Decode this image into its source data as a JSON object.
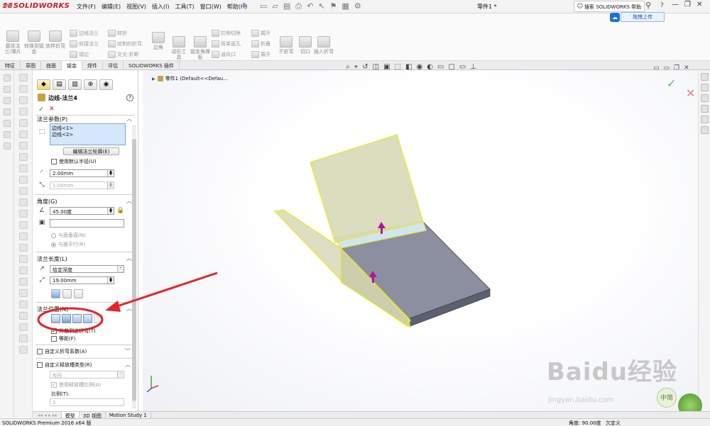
{
  "app": {
    "brand": "SOLIDWORKS",
    "document_title": "零件1 *"
  },
  "menu": [
    "文件(F)",
    "编辑(E)",
    "视图(V)",
    "插入(I)",
    "工具(T)",
    "窗口(W)",
    "帮助(H)"
  ],
  "search": {
    "placeholder": "搜索 SOLIDWORKS 帮助"
  },
  "upload_button": "拖拽上传",
  "ribbon": {
    "big": [
      "基体法兰/薄片",
      "转换到钣金",
      "放样折弯"
    ],
    "col1": [
      "边线法兰",
      "斜接法兰",
      "褶边"
    ],
    "col2": [
      "转折",
      "绘制的折弯",
      "交叉-折断"
    ],
    "corner": "边角",
    "forming": "成形工具",
    "gusset": "钣金角撑板",
    "col3": [
      "拉伸切除",
      "简单直孔",
      "通风口"
    ],
    "col4": [
      "展开",
      "折叠",
      "展开"
    ],
    "nofold": "不折弯",
    "rip": "切口",
    "insert_bends": "插入折弯"
  },
  "tabs": [
    "特征",
    "草图",
    "曲面",
    "钣金",
    "焊件",
    "评估",
    "SOLIDWORKS 插件"
  ],
  "active_tab_index": 3,
  "pm": {
    "title": "边线-法兰4",
    "sections": {
      "params": "法兰参数(P)",
      "angle": "角度(G)",
      "length": "法兰长度(L)",
      "position": "法兰位置(N)",
      "custom_bend": "自定义折弯系数(A)",
      "custom_relief": "自定义释放槽类型(R)"
    },
    "edges": [
      "边线<1>",
      "边线<2>"
    ],
    "edit_profile_button": "编辑法兰轮廓(E)",
    "use_default_radius": "使用默认半径(U)",
    "radius_value": "2.00mm",
    "thickness_value": "1.00mm",
    "angle_value": "45.00度",
    "radio_perpendicular": "与面垂直(N)",
    "radio_parallel": "与面平行(R)",
    "length_type": "给定深度",
    "length_value": "19.00mm",
    "trim_side_bends": "剪裁侧边折弯(T)",
    "offset": "等距(F)",
    "relief_type": "矩形",
    "use_relief_ratio": "使用释放槽比例(A)",
    "ratio_label": "比例(T):",
    "ratio_value": "1"
  },
  "tree_root": "零件1 (Default<<Defau...",
  "bottom_tabs": [
    "模型",
    "3D 视图",
    "Motion Study 1"
  ],
  "status": {
    "left": "SOLIDWORKS Premium 2016 x64 版",
    "angle": "角度: 90.00度",
    "defined": "欠定义"
  },
  "watermark": {
    "text": "Baidu经验",
    "url": "jingyan.baidu.com",
    "badge": "中简"
  },
  "colors": {
    "annotation_red": "#e0262b",
    "flange_yellow": "#e8e832",
    "arrow_magenta": "#b0159c",
    "plate_gray": "#8c8f9f"
  }
}
